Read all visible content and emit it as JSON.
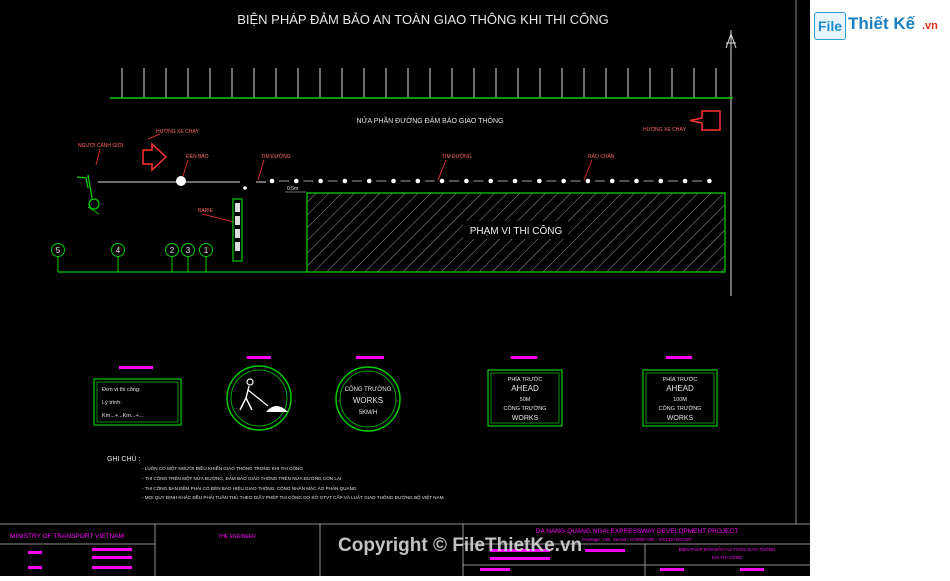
{
  "title": "BIỆN PHÁP ĐẢM BẢO AN TOÀN GIAO THÔNG KHI THI CÔNG",
  "plan": {
    "half_road": "NỬA PHẦN ĐƯỜNG ĐẢM BẢO GIAO THÔNG",
    "nguoi_canh_gioi": "NGƯỜI CẢNH GIỚI",
    "huong_xe_chay_left": "HƯỚNG XE CHẠY",
    "huong_xe_chay_right": "HƯỚNG XE CHẠY",
    "den_bao": "ĐÈN BÁO",
    "tim_duong_1": "TIM ĐƯỜNG",
    "tim_duong_2": "TIM ĐƯỜNG",
    "rao_chan": "RÀO CHẮN",
    "spacing": "0.5m",
    "barie": "BARIE",
    "work_zone": "PHẠM VI THI CÔNG",
    "markers": [
      "5",
      "4",
      "2",
      "3",
      "1"
    ]
  },
  "signs": {
    "info_board": {
      "line1": "Đơn vị thi công:",
      "line2": "Lý trình:",
      "line3": "Km...+...Km...+..."
    },
    "speed_sign": {
      "line1": "CÔNG TRƯỜNG",
      "line2": "WORKS",
      "line3": "5KM/H"
    },
    "ahead_50": {
      "line1": "PHÍA TRƯỚC",
      "line2": "AHEAD",
      "line3": "50M",
      "line4": "CÔNG TRƯỜNG",
      "line5": "WORKS"
    },
    "ahead_100": {
      "line1": "PHÍA TRƯỚC",
      "line2": "AHEAD",
      "line3": "100M",
      "line4": "CÔNG TRƯỜNG",
      "line5": "WORKS"
    }
  },
  "notes": {
    "heading": "GHI CHÚ :",
    "items": [
      "- LUÔN CÓ MỘT NGƯỜI ĐIỀU KHIỂN GIAO THÔNG TRONG KHI THI CÔNG",
      "- THI CÔNG TRÊN MỘT NỬA ĐƯỜNG, ĐẢM BẢO GIAO THÔNG TRÊN NỬA ĐƯỜNG CÒN LẠI",
      "- THI CÔNG BAN ĐÊM PHẢI CÓ ĐÈN BÁO HIỆU GIAO THÔNG, CÔNG NHÂN MẶC ÁO PHẢN QUANG",
      "- MỌI QUY ĐỊNH KHÁC ĐỀU PHẢI TUÂN THỦ THEO GIẤY PHÉP THI CÔNG DO SỞ GTVT CẤP VÀ LUẬT GIAO THÔNG ĐƯỜNG BỘ VIỆT NAM"
    ]
  },
  "title_block": {
    "ministry": "MINISTRY OF TRANSPORT VIETNAM",
    "engineer": "THE ENGINEER",
    "project": "DA NANG-QUANG NGAI EXPRESSWAY DEVELOPMENT PROJECT",
    "package": "Package: 14B, Section: Km065+000 - Km139+203.827",
    "sheet_title_1": "BIỆN PHÁP ĐẢM BẢO AN TOÀN GIAO THÔNG",
    "sheet_title_2": "KHI THI CÔNG"
  },
  "logo": {
    "file": "File",
    "thiet_ke": "Thiết Kế",
    "vn": ".vn"
  },
  "watermark": "Copyright © FileThietKe.vn",
  "colors": {
    "background": "#000000",
    "road": "#00cc00",
    "labels": "#ff3333",
    "marker": "#ff00ff",
    "title": "#e6e6e6"
  }
}
